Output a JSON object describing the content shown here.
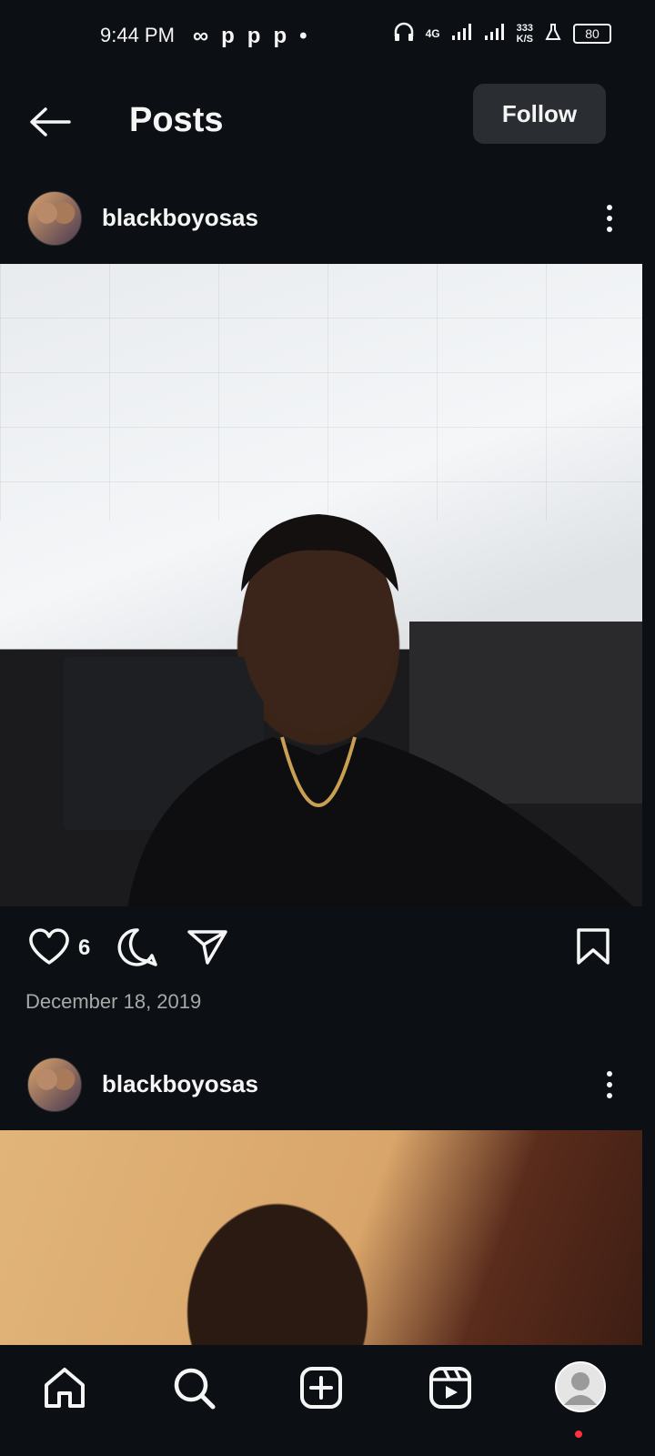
{
  "status_bar": {
    "time": "9:44 PM",
    "apps": [
      "p",
      "p",
      "p",
      "•"
    ],
    "network": "4G",
    "speed_value": "333",
    "speed_unit": "K/S",
    "battery": "80"
  },
  "header": {
    "title": "Posts",
    "follow_label": "Follow"
  },
  "posts": [
    {
      "username": "blackboyosas",
      "likes": "6",
      "date": "December 18, 2019"
    },
    {
      "username": "blackboyosas"
    }
  ],
  "colors": {
    "background": "#0c1014",
    "button": "#2a2e33",
    "notification": "#ff3040"
  },
  "nav": {
    "items": [
      "home-icon",
      "search-icon",
      "create-icon",
      "reels-icon",
      "profile-icon"
    ]
  }
}
